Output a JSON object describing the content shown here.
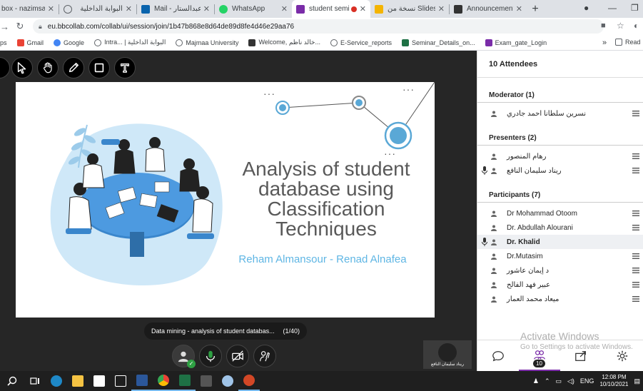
{
  "browser": {
    "tabs": [
      {
        "label": "box - nazimsa",
        "icon": "mail-icon",
        "color": "#d54b3d"
      },
      {
        "label": "البوابة الداخلية",
        "icon": "globe-icon",
        "color": "#5f6368"
      },
      {
        "label": "Mail - عبدالستار ...",
        "icon": "outlook-icon",
        "color": "#0a64ad"
      },
      {
        "label": "WhatsApp",
        "icon": "whatsapp-icon",
        "color": "#25d366"
      },
      {
        "label": "student semi",
        "icon": "collaborate-icon",
        "color": "#7a2ca8"
      },
      {
        "label": "نسخة من Slides",
        "icon": "slides-icon",
        "color": "#f4b400"
      },
      {
        "label": "Announcements",
        "icon": "blackboard-icon",
        "color": "#333"
      }
    ],
    "url": "eu.bbcollab.com/collab/ui/session/join/1b47b868e8d64de89d8fe4d46e29aa76",
    "bookmarks": [
      {
        "label": "ps",
        "color": "#4285f4"
      },
      {
        "label": "Gmail",
        "color": "#ea4335"
      },
      {
        "label": "Google",
        "color": "#4285f4"
      },
      {
        "label": "Intra... | البوابة الداخلية",
        "color": "#5f6368"
      },
      {
        "label": "Majmaa University",
        "color": "#5f6368"
      },
      {
        "label": "Welcome, خالد ناظم...",
        "color": "#333"
      },
      {
        "label": "E-Service_reports",
        "color": "#5f6368"
      },
      {
        "label": "Seminar_Details_on...",
        "color": "#1e7145"
      },
      {
        "label": "Exam_gate_Login",
        "color": "#7a2ca8"
      },
      {
        "label": "Read",
        "color": "#5f6368"
      }
    ],
    "more": "»"
  },
  "slide": {
    "title": "Analysis of student database using Classification Techniques",
    "authors": "Reham Almansour -  Renad Alnafea"
  },
  "file_info": {
    "name": "Data mining - analysis of student databas...",
    "page": "(1/40)"
  },
  "speaker_tile": {
    "name": "ريناد سليمان النافع"
  },
  "attendees": {
    "header": "10 Attendees",
    "groups": [
      {
        "title": "Moderator (1)",
        "members": [
          {
            "name": "نسرين سلطانا احمد جادري",
            "mic": false,
            "bold": false
          }
        ]
      },
      {
        "title": "Presenters (2)",
        "members": [
          {
            "name": "رهام المنصور",
            "mic": false,
            "bold": false
          },
          {
            "name": "ريناد سليمان النافع",
            "mic": true,
            "bold": false
          }
        ]
      },
      {
        "title": "Participants (7)",
        "members": [
          {
            "name": "Dr Mohammad Otoom",
            "mic": false,
            "bold": false
          },
          {
            "name": "Dr. Abdullah Alourani",
            "mic": false,
            "bold": false
          },
          {
            "name": "Dr. Khalid",
            "mic": true,
            "bold": true
          },
          {
            "name": "Dr.Mutasim",
            "mic": false,
            "bold": false
          },
          {
            "name": "د إيمان عاشور",
            "mic": false,
            "bold": false
          },
          {
            "name": "عبير فهد الفالح",
            "mic": false,
            "bold": false
          },
          {
            "name": "ميعاد محمد العمار",
            "mic": false,
            "bold": false
          }
        ]
      }
    ],
    "badge_count": "10"
  },
  "watermark": {
    "line1": "Activate Windows",
    "line2": "Go to Settings to activate Windows."
  },
  "taskbar": {
    "lang": "ENG",
    "time": "12:08 PM",
    "date": "10/10/2021"
  },
  "colors": {
    "accent": "#7a2ca8",
    "mic_green": "#2ea043",
    "subtitle_blue": "#5fb6e4"
  }
}
